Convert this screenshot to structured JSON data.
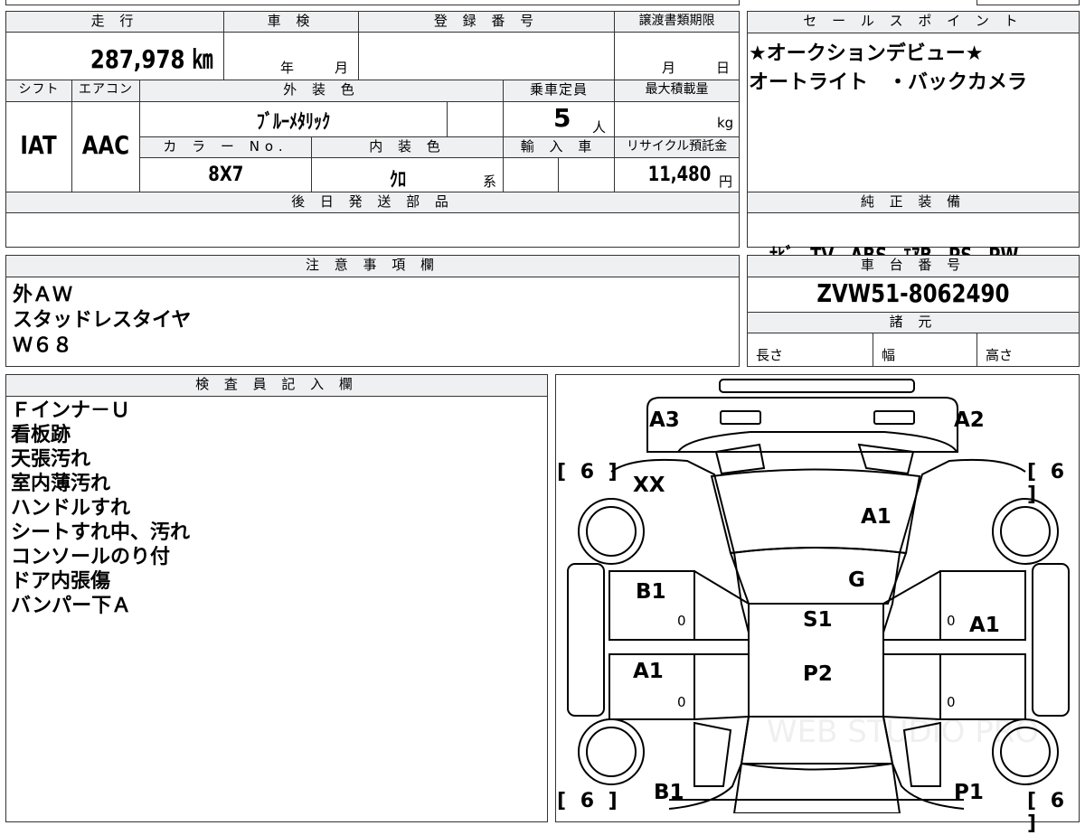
{
  "header": {
    "mileage_label": "走 行",
    "shaken_label": "車 検",
    "registration_label": "登 録 番 号",
    "transfer_label": "譲渡書類期限",
    "sales_label": "セ ー ル ス ポ イ ン ト",
    "mileage_value": "287,978 ㎞",
    "shaken_year": "年",
    "shaken_month": "月",
    "transfer_month": "月",
    "transfer_day": "日"
  },
  "specs": {
    "shift_label": "シフト",
    "aircon_label": "エアコン",
    "exterior_color_label": "外 装 色",
    "capacity_label": "乗車定員",
    "max_load_label": "最大積載量",
    "color_no_label": "カ ラ ー No.",
    "interior_color_label": "内 装 色",
    "import_label": "輸 入 車",
    "recycle_label": "リサイクル預託金",
    "shift_value": "IAT",
    "aircon_value": "AAC",
    "exterior_color_value": "ﾌﾞﾙｰﾒﾀﾘｯｸ",
    "capacity_value": "5",
    "capacity_unit": "人",
    "max_load_unit": "kg",
    "color_no_value": "8X7",
    "interior_color_value": "ｸﾛ",
    "interior_color_suffix": "系",
    "recycle_value": "11,480",
    "recycle_unit": "円"
  },
  "later_parts": {
    "label": "後 日 発 送 部 品"
  },
  "sales_points": {
    "lines": [
      "★オークションデビュー★",
      "オートライト　・バックカメラ"
    ]
  },
  "genuine_equipment": {
    "label": "純 正 装 備",
    "value": "ﾅﾋﾞ　TV　ABS　ｴｱB　PS　PW"
  },
  "notes": {
    "label": "注 意 事 項 欄",
    "lines": [
      "外ＡＷ",
      "スタッドレスタイヤ",
      "Ｗ６８"
    ]
  },
  "chassis": {
    "label": "車 台 番 号",
    "value": "ZVW51-8062490",
    "specs_label": "諸 元",
    "length_label": "長さ",
    "width_label": "幅",
    "height_label": "高さ"
  },
  "inspector": {
    "label": "検 査 員 記 入 欄",
    "lines": [
      "Ｆインナ－Ｕ",
      "看板跡",
      "天張汚れ",
      "室内薄汚れ",
      "ハンドルすれ",
      "シートすれ中、汚れ",
      "コンソールのり付",
      "ドア内張傷",
      "バンパー下Ａ"
    ]
  },
  "diagram": {
    "marks": {
      "rear_left": "A3",
      "rear_right": "A2",
      "tread_rl": "[ 6 ]",
      "tread_rr": "[ 6 ]",
      "tread_fl": "[ 6 ]",
      "tread_fr": "[ 6 ]",
      "rear_glass": "XX",
      "roof": "A1",
      "windshield_rear": "G",
      "left_rear_door": "B1",
      "right_rear_door": "A1",
      "left_front_door": "A1",
      "seat": "S1",
      "floor": "P2",
      "left_front": "B1",
      "right_front": "P1",
      "zero_lr": "0",
      "zero_rr": "0",
      "zero_lf": "0",
      "zero_rf": "0"
    },
    "watermark": "WEB STUDIO PRO"
  }
}
